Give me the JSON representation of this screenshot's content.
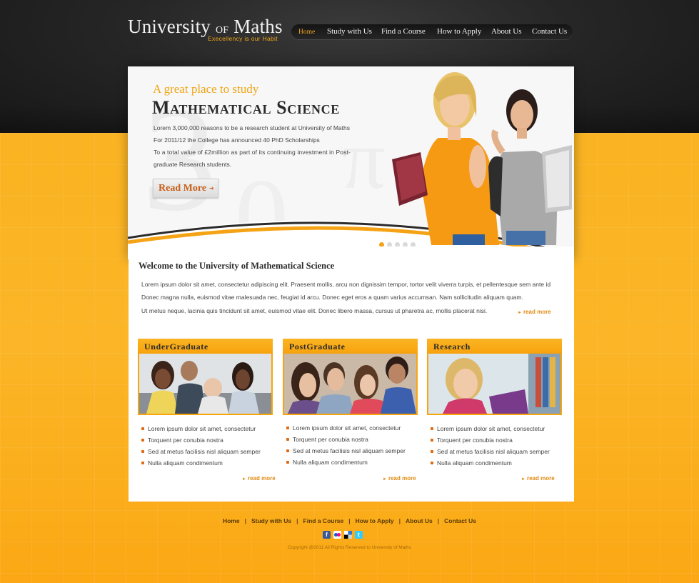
{
  "header": {
    "logo_main": "University",
    "logo_of": "of",
    "logo_end": "Maths",
    "tagline": "Execellency is our Habit",
    "nav": [
      "Home",
      "Study with Us",
      "Find a  Course",
      "How to Apply",
      "About Us",
      "Contact Us"
    ],
    "active_nav": "Home"
  },
  "hero": {
    "subtitle": "A great place to study",
    "title": "Mathematical Science",
    "lines": [
      "Lorem 3,000,000 reasons to be a research student at University of Maths",
      "For 2011/12 the College has announced 40 PhD Scholarships",
      "To a total value of £2million as part of its continuing investment in Post-",
      "graduate Research students."
    ],
    "button": "Read More",
    "slides_total": 5,
    "slide_active": 1
  },
  "welcome": {
    "title": "Welcome to the University of Mathematical Science",
    "lines": [
      "Lorem ipsum dolor sit amet, consectetur adipiscing elit. Praesent mollis, arcu non dignissim tempor, tortor velit viverra turpis, et pellentesque sem ante id",
      "Donec magna nulla, euismod vitae malesuada nec, feugiat id arcu. Donec eget eros a quam varius accumsan. Nam sollicitudin aliquam quam.",
      "Ut metus neque, lacinia quis tincidunt sit amet, euismod vitae elit. Donec libero massa, cursus ut pharetra ac, mollis placerat nisi."
    ],
    "read_more": "read more"
  },
  "cards": [
    {
      "title": "UnderGraduate",
      "bullets": [
        "Lorem ipsum dolor sit amet, consectetur",
        "Torquent per conubia nostra",
        "Sed at metus facilisis nisl aliquam semper",
        "Nulla aliquam condimentum"
      ],
      "read_more": "read more"
    },
    {
      "title": "PostGraduate",
      "bullets": [
        "Lorem ipsum dolor sit amet, consectetur",
        "Torquent per conubia nostra",
        "Sed at metus facilisis nisl aliquam semper",
        "Nulla aliquam condimentum"
      ],
      "read_more": "read more"
    },
    {
      "title": "Research",
      "bullets": [
        "Lorem ipsum dolor sit amet, consectetur",
        "Torquent per conubia nostra",
        "Sed at metus facilisis nisl aliquam semper",
        "Nulla aliquam condimentum"
      ],
      "read_more": "read more"
    }
  ],
  "footer": {
    "nav": [
      "Home",
      "Study with Us",
      "Find a  Course",
      "How to Apply",
      "About Us",
      "Contact Us"
    ],
    "social": [
      "facebook-icon",
      "flickr-icon",
      "delicious-icon",
      "twitter-icon"
    ],
    "copyright": "Copyright @2011 All Rights Reserved to University of Maths"
  },
  "colors": {
    "accent": "#f5a316",
    "dark": "#262626",
    "link": "#e08a12"
  }
}
